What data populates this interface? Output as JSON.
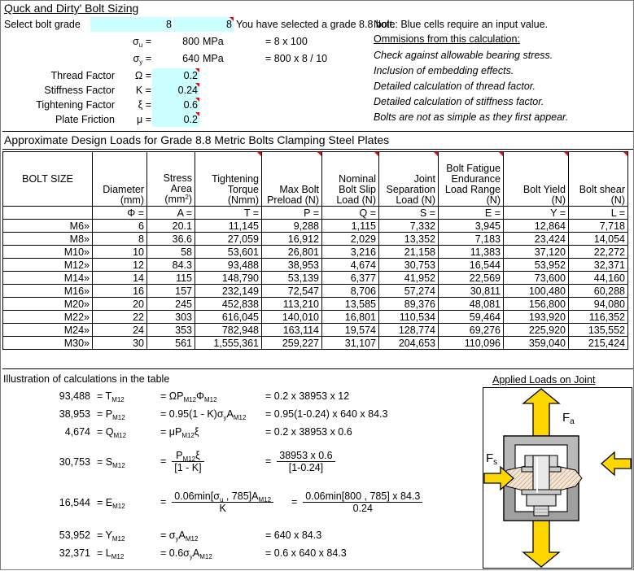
{
  "colors": {
    "input_cell": "#ccffff",
    "note_marker": "#ff0000",
    "arrow_fill": "#ffd700",
    "plate_fill": "#a6a6a6",
    "bolt_fill": "#d9d9d9"
  },
  "header": {
    "title": "Quck and Dirty' Bolt Sizing",
    "grade_label": "Select bolt grade",
    "grade_value_1": "8",
    "grade_value_2": "8",
    "grade_message": "You have selected a grade 8.8 bolt.",
    "rows": [
      {
        "label": "",
        "symbol": "σu =",
        "value": "800",
        "unit": "MPa",
        "formula": "= 8 x 100",
        "input": false
      },
      {
        "label": "",
        "symbol": "σy =",
        "value": "640",
        "unit": "MPa",
        "formula": "= 800 x 8 / 10",
        "input": false
      },
      {
        "label": "Thread Factor",
        "symbol": "Ω =",
        "value": "0.2",
        "unit": "",
        "formula": "",
        "input": true
      },
      {
        "label": "Stiffness Factor",
        "symbol": "K =",
        "value": "0.24",
        "unit": "",
        "formula": "",
        "input": true
      },
      {
        "label": "Tightening Factor",
        "symbol": "ξ =",
        "value": "0.6",
        "unit": "",
        "formula": "",
        "input": true
      },
      {
        "label": "Plate Friction",
        "symbol": "μ =",
        "value": "0.2",
        "unit": "",
        "formula": "",
        "input": true
      }
    ],
    "note": "Note: Blue cells require an input value.",
    "omissions_title": "Ommisions from this calculation:",
    "omissions": [
      "Check against allowable bearing stress.",
      "Inclusion of embedding effects.",
      "Detailed calculation of thread factor.",
      "Detailed calculation of stiffness factor.",
      "Bolts are not as simple as they first appear."
    ]
  },
  "table": {
    "title": "Approximate Design Loads for Grade 8.8 Metric Bolts Clamping Steel Plates",
    "columns": [
      {
        "label": "BOLT SIZE",
        "symbol": "",
        "note": false
      },
      {
        "label": "Diameter (mm)",
        "symbol": "Φ =",
        "note": false
      },
      {
        "label": "Stress Area (mm2)",
        "symbol": "A =",
        "note": false
      },
      {
        "label": "Tightening Torque (Nmm)",
        "symbol": "T =",
        "note": true
      },
      {
        "label": "Max Bolt Preload (N)",
        "symbol": "P =",
        "note": true
      },
      {
        "label": "Nominal Bolt Slip Load (N)",
        "symbol": "Q =",
        "note": true
      },
      {
        "label": "Joint Separation Load (N)",
        "symbol": "S =",
        "note": true
      },
      {
        "label": "Bolt Fatigue Endurance Load Range (N)",
        "symbol": "E =",
        "note": true
      },
      {
        "label": "Bolt Yield (N)",
        "symbol": "Y =",
        "note": true
      },
      {
        "label": "Bolt shear (N)",
        "symbol": "L =",
        "note": true
      }
    ],
    "rows": [
      [
        "M6»",
        "6",
        "20.1",
        "11,145",
        "9,288",
        "1,115",
        "7,332",
        "3,945",
        "12,864",
        "7,718"
      ],
      [
        "M8»",
        "8",
        "36.6",
        "27,059",
        "16,912",
        "2,029",
        "13,352",
        "7,183",
        "23,424",
        "14,054"
      ],
      [
        "M10»",
        "10",
        "58",
        "53,601",
        "26,801",
        "3,216",
        "21,158",
        "11,383",
        "37,120",
        "22,272"
      ],
      [
        "M12»",
        "12",
        "84.3",
        "93,488",
        "38,953",
        "4,674",
        "30,753",
        "16,544",
        "53,952",
        "32,371"
      ],
      [
        "M14»",
        "14",
        "115",
        "148,790",
        "53,139",
        "6,377",
        "41,952",
        "22,569",
        "73,600",
        "44,160"
      ],
      [
        "M16»",
        "16",
        "157",
        "232,149",
        "72,547",
        "8,706",
        "57,274",
        "30,811",
        "100,480",
        "60,288"
      ],
      [
        "M20»",
        "20",
        "245",
        "452,838",
        "113,210",
        "13,585",
        "89,376",
        "48,081",
        "156,800",
        "94,080"
      ],
      [
        "M22»",
        "22",
        "303",
        "616,045",
        "140,010",
        "16,801",
        "110,534",
        "59,464",
        "193,920",
        "116,352"
      ],
      [
        "M24»",
        "24",
        "353",
        "782,948",
        "163,114",
        "19,574",
        "128,774",
        "69,276",
        "225,920",
        "135,552"
      ],
      [
        "M30»",
        "30",
        "561",
        "1,555,361",
        "259,227",
        "31,107",
        "204,653",
        "110,096",
        "359,040",
        "215,424"
      ]
    ]
  },
  "calc": {
    "title": "Illustration of calculations in the table",
    "lines": [
      {
        "value": "93,488",
        "eq_sym": "= T",
        "sub": "M12",
        "rhs_numeric": "= 0.2 x 38953 x 12"
      },
      {
        "value": "38,953",
        "eq_sym": "= P",
        "sub": "M12",
        "rhs_numeric": "= 0.95(1-0.24) x 640 x 84.3"
      },
      {
        "value": "4,674",
        "eq_sym": "= Q",
        "sub": "M12",
        "rhs_numeric": "= 0.2 x 38953 x 0.6"
      },
      {
        "value": "30,753",
        "eq_sym": "= S",
        "sub": "M12",
        "rhs_numeric": ""
      },
      {
        "value": "16,544",
        "eq_sym": "= E",
        "sub": "M12",
        "rhs_numeric": ""
      },
      {
        "value": "53,952",
        "eq_sym": "= Y",
        "sub": "M12",
        "rhs_numeric": "= 640 x 84.3"
      },
      {
        "value": "32,371",
        "eq_sym": "= L",
        "sub": "M12",
        "rhs_numeric": "= 0.6 x 640 x 84.3"
      }
    ],
    "formula_T": "= ΩP",
    "formula_T_sub1": "M12",
    "formula_T_phi": "Φ",
    "formula_T_sub2": "M12",
    "formula_P": "= 0.95(1 - K)σ",
    "formula_P_suby": "y",
    "formula_P_A": "A",
    "formula_P_sub": "M12",
    "formula_Q": "= μP",
    "formula_Q_sub": "M12",
    "formula_Q_xi": "ξ",
    "formula_S_num": "P",
    "formula_S_num_sub": "M12",
    "formula_S_num_xi": "ξ",
    "formula_S_den": "[1 - K]",
    "formula_S_rhs_num": "38953 x 0.6",
    "formula_S_rhs_den": "[1-0.24]",
    "formula_E_num": "0.06min[σ",
    "formula_E_num_subu": "u",
    "formula_E_num_rest": " , 785]A",
    "formula_E_num_sub": "M12",
    "formula_E_den": "K",
    "formula_E_rhs_num": "0.06min[800 , 785] x 84.3",
    "formula_E_rhs_den": "0.24",
    "formula_Y": "= σ",
    "formula_Y_suby": "y",
    "formula_Y_A": "A",
    "formula_Y_sub": "M12",
    "formula_L": "= 0.6σ",
    "formula_L_suby": "y",
    "formula_L_A": "A",
    "formula_L_sub": "M12",
    "eq_sign": "="
  },
  "diagram": {
    "title": "Applied Loads on Joint",
    "label_fa": "Fa",
    "label_fa_main": "F",
    "label_fa_sub": "a",
    "label_fs_main": "F",
    "label_fs_sub": "s"
  }
}
